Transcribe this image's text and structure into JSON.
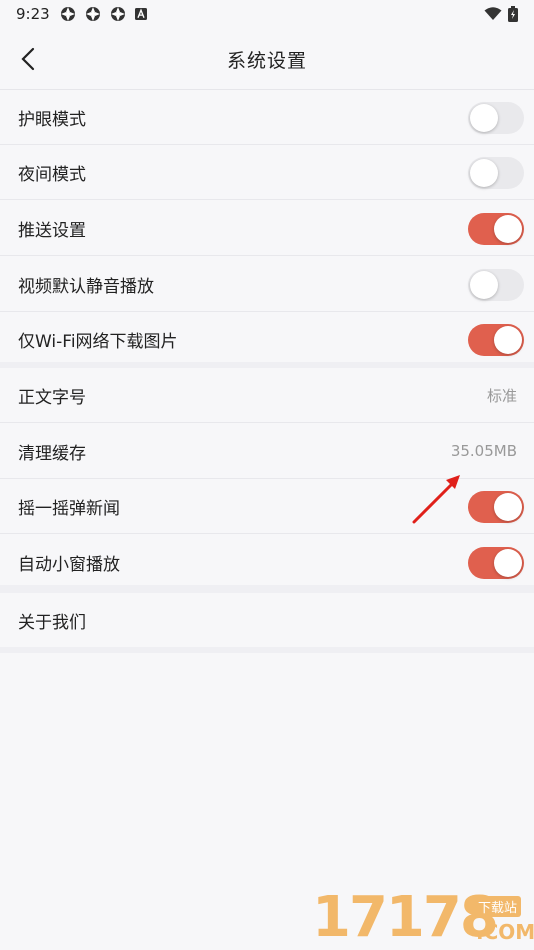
{
  "status_bar": {
    "time": "9:23",
    "notification_icons": [
      "app-icon",
      "app-icon",
      "app-icon",
      "a-icon"
    ],
    "right_icons": [
      "wifi-icon",
      "battery-charging-icon"
    ]
  },
  "header": {
    "title": "系统设置",
    "back_icon": "chevron-left-icon"
  },
  "settings": [
    {
      "label": "护眼模式",
      "toggle": false
    },
    {
      "label": "夜间模式",
      "toggle": false
    },
    {
      "label": "推送设置",
      "toggle": true
    },
    {
      "label": "视频默认静音播放",
      "toggle": false
    },
    {
      "label": "仅Wi-Fi网络下载图片",
      "toggle": true
    },
    {
      "label": "正文字号",
      "value": "标准"
    },
    {
      "label": "清理缓存",
      "value": "35.05MB"
    },
    {
      "label": "摇一摇弹新闻",
      "toggle": true
    },
    {
      "label": "自动小窗播放",
      "toggle": true
    },
    {
      "label": "关于我们"
    }
  ],
  "colors": {
    "toggle_on": "#e0604e",
    "toggle_off": "#e9e9ec",
    "annotation_arrow": "#e0201a"
  },
  "watermark": {
    "number": "17178",
    "badge": "下载站",
    "suffix": ".COM"
  }
}
